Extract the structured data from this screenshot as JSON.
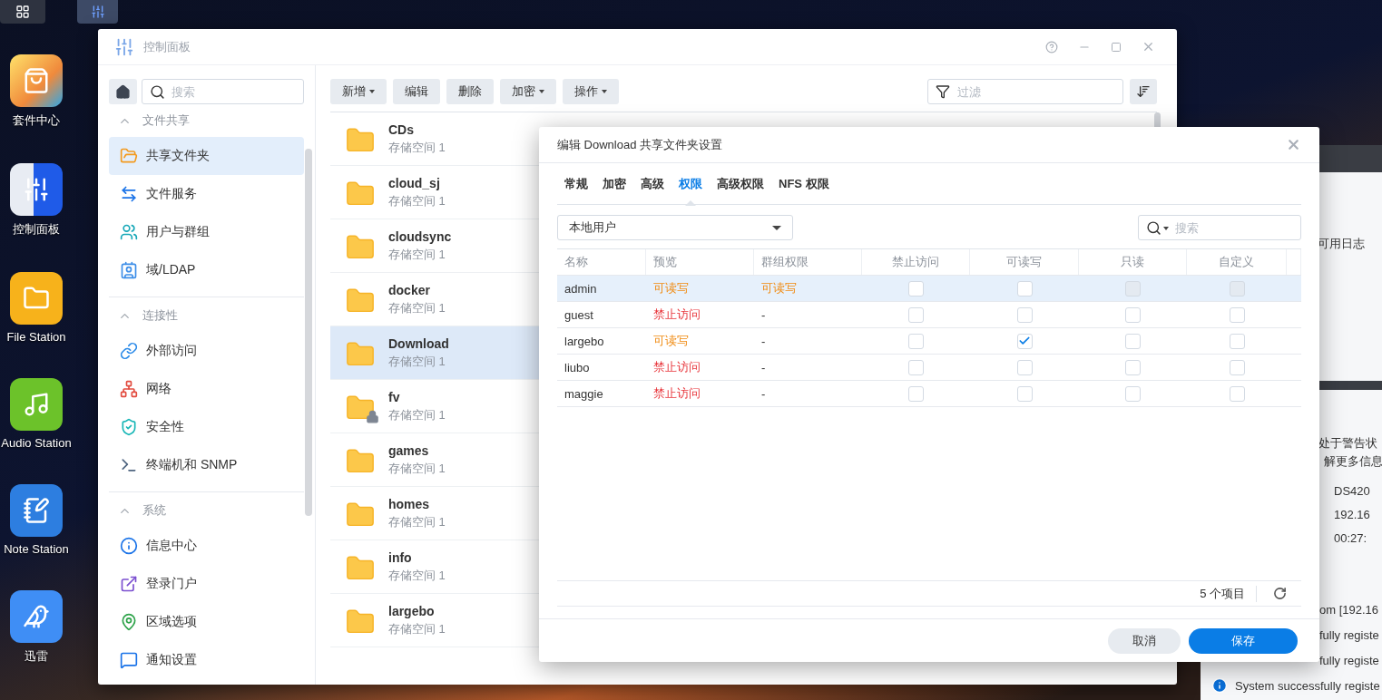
{
  "taskbar": {
    "buttons": [
      {
        "selected": false
      },
      {
        "selected": true
      }
    ]
  },
  "desktop_icons": [
    {
      "label": "套件中心"
    },
    {
      "label": "控制面板"
    },
    {
      "label": "File Station"
    },
    {
      "label": "Audio Station"
    },
    {
      "label": "Note Station"
    },
    {
      "label": "迅雷"
    }
  ],
  "window": {
    "title": "控制面板",
    "sidebar": {
      "search": {
        "placeholder": "搜索"
      },
      "sections": [
        {
          "title": "文件共享",
          "expanded": true,
          "items": [
            {
              "label": "共享文件夹",
              "selected": true
            },
            {
              "label": "文件服务",
              "selected": false
            },
            {
              "label": "用户与群组",
              "selected": false
            },
            {
              "label": "域/LDAP",
              "selected": false
            }
          ]
        },
        {
          "title": "连接性",
          "expanded": true,
          "items": [
            {
              "label": "外部访问",
              "selected": false
            },
            {
              "label": "网络",
              "selected": false
            },
            {
              "label": "安全性",
              "selected": false
            },
            {
              "label": "终端机和 SNMP",
              "selected": false
            }
          ]
        },
        {
          "title": "系统",
          "expanded": true,
          "items": [
            {
              "label": "信息中心",
              "selected": false
            },
            {
              "label": "登录门户",
              "selected": false
            },
            {
              "label": "区域选项",
              "selected": false
            },
            {
              "label": "通知设置",
              "selected": false
            }
          ]
        }
      ]
    },
    "toolbar": {
      "buttons": [
        {
          "label": "新增",
          "dropdown": true
        },
        {
          "label": "编辑",
          "dropdown": false
        },
        {
          "label": "删除",
          "dropdown": false
        },
        {
          "label": "加密",
          "dropdown": true
        },
        {
          "label": "操作",
          "dropdown": true
        }
      ],
      "filter": {
        "placeholder": "过滤"
      }
    },
    "folders": [
      {
        "name": "CDs",
        "volume": "存储空间 1",
        "locked": false,
        "selected": false
      },
      {
        "name": "cloud_sj",
        "volume": "存储空间 1",
        "locked": false,
        "selected": false
      },
      {
        "name": "cloudsync",
        "volume": "存储空间 1",
        "locked": false,
        "selected": false
      },
      {
        "name": "docker",
        "volume": "存储空间 1",
        "locked": false,
        "selected": false
      },
      {
        "name": "Download",
        "volume": "存储空间 1",
        "locked": false,
        "selected": true
      },
      {
        "name": "fv",
        "volume": "存储空间 1",
        "locked": true,
        "selected": false
      },
      {
        "name": "games",
        "volume": "存储空间 1",
        "locked": false,
        "selected": false
      },
      {
        "name": "homes",
        "volume": "存储空间 1",
        "locked": false,
        "selected": false
      },
      {
        "name": "info",
        "volume": "存储空间 1",
        "locked": false,
        "selected": false
      },
      {
        "name": "largebo",
        "volume": "存储空间 1",
        "locked": false,
        "selected": false
      }
    ]
  },
  "dialog": {
    "title": "编辑 Download 共享文件夹设置",
    "tabs": [
      {
        "label": "常规",
        "selected": false
      },
      {
        "label": "加密",
        "selected": false
      },
      {
        "label": "高级",
        "selected": false
      },
      {
        "label": "权限",
        "selected": true
      },
      {
        "label": "高级权限",
        "selected": false
      },
      {
        "label": "NFS 权限",
        "selected": false
      }
    ],
    "user_type": "本地用户",
    "search": {
      "placeholder": "搜索"
    },
    "table": {
      "columns": [
        "名称",
        "预览",
        "群组权限",
        "禁止访问",
        "可读写",
        "只读",
        "自定义"
      ],
      "rows": [
        {
          "name": "admin",
          "selected": true,
          "preview": {
            "text": "可读写",
            "color": "#f08a10"
          },
          "group": {
            "text": "可读写",
            "color": "#f08a10"
          },
          "perms": [
            {
              "checked": false,
              "disabled": false
            },
            {
              "checked": false,
              "disabled": false
            },
            {
              "checked": false,
              "disabled": true
            },
            {
              "checked": false,
              "disabled": true
            }
          ]
        },
        {
          "name": "guest",
          "selected": false,
          "preview": {
            "text": "禁止访问",
            "color": "#e8363c"
          },
          "group": {
            "text": "-"
          },
          "perms": [
            {
              "checked": false,
              "disabled": false
            },
            {
              "checked": false,
              "disabled": false
            },
            {
              "checked": false,
              "disabled": false
            },
            {
              "checked": false,
              "disabled": false
            }
          ]
        },
        {
          "name": "largebo",
          "selected": false,
          "preview": {
            "text": "可读写",
            "color": "#f08a10"
          },
          "group": {
            "text": "-"
          },
          "perms": [
            {
              "checked": false,
              "disabled": false
            },
            {
              "checked": true,
              "disabled": false
            },
            {
              "checked": false,
              "disabled": false
            },
            {
              "checked": false,
              "disabled": false
            }
          ]
        },
        {
          "name": "liubo",
          "selected": false,
          "preview": {
            "text": "禁止访问",
            "color": "#e8363c"
          },
          "group": {
            "text": "-"
          },
          "perms": [
            {
              "checked": false,
              "disabled": false
            },
            {
              "checked": false,
              "disabled": false
            },
            {
              "checked": false,
              "disabled": false
            },
            {
              "checked": false,
              "disabled": false
            }
          ]
        },
        {
          "name": "maggie",
          "selected": false,
          "preview": {
            "text": "禁止访问",
            "color": "#e8363c"
          },
          "group": {
            "text": "-"
          },
          "perms": [
            {
              "checked": false,
              "disabled": false
            },
            {
              "checked": false,
              "disabled": false
            },
            {
              "checked": false,
              "disabled": false
            },
            {
              "checked": false,
              "disabled": false
            }
          ]
        }
      ],
      "count": "5 个项目"
    },
    "buttons": [
      {
        "label": "取消",
        "kind": "secondary"
      },
      {
        "label": "保存",
        "kind": "primary"
      }
    ]
  },
  "background_widget": {
    "log_status": "可用日志",
    "warning_lines": [
      "处于警告状",
      "解更多信息"
    ],
    "info_values": [
      "DS420",
      "192.16",
      "00:27:"
    ]
  },
  "log_lines": [
    {
      "text": "om [192.16",
      "icon": false
    },
    {
      "text": "fully registe",
      "icon": false
    },
    {
      "text": "fully registe",
      "icon": false
    },
    {
      "text": "System successfully registe",
      "icon": true
    }
  ]
}
